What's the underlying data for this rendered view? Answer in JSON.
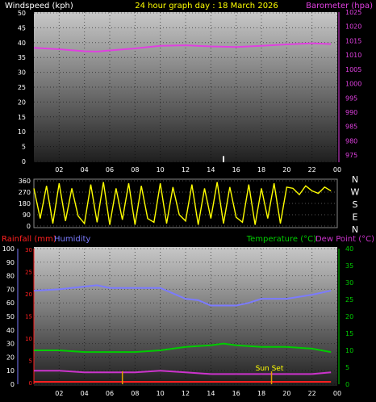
{
  "header": {
    "left": "Windspeed (kph)",
    "center": "24 hour graph day : 18 March 2026",
    "right": "Barometer (hpa)"
  },
  "legend_row": {
    "rainfall": "Rainfall (mm)",
    "humidity": "Humidity",
    "temperature": "Temperature (°C)",
    "dew_point": "Dew Point (°C)"
  },
  "annotations": {
    "sun_set": "Sun Set"
  },
  "colors": {
    "background": "#000000",
    "barometer": "#e040e0",
    "windspeed": "#ffffff",
    "direction": "#ffff00",
    "temperature": "#00cc00",
    "dew_point": "#cc33cc",
    "humidity": "#7b7bff",
    "rainfall": "#ff2020",
    "axis_text": "#ffffff",
    "title": "#ffff00"
  },
  "chart_data": [
    {
      "type": "line",
      "x_ticks": [
        "02",
        "04",
        "06",
        "08",
        "10",
        "12",
        "14",
        "16",
        "18",
        "20",
        "22",
        "00"
      ],
      "y_left": {
        "label": "Windspeed (kph)",
        "ticks": [
          0,
          5,
          10,
          15,
          20,
          25,
          30,
          35,
          40,
          45,
          50
        ],
        "range": [
          0,
          50
        ]
      },
      "y_right": {
        "label": "Barometer (hpa)",
        "ticks": [
          975,
          980,
          985,
          990,
          995,
          1000,
          1005,
          1010,
          1015,
          1020,
          1025
        ],
        "range": [
          972.5,
          1025
        ]
      },
      "series": [
        {
          "name": "Barometer (hpa)",
          "axis": "right",
          "x": [
            0,
            2,
            4,
            5,
            6,
            8,
            10,
            12,
            14,
            16,
            18,
            20,
            22,
            23.5
          ],
          "values": [
            1012.5,
            1012,
            1011.3,
            1011.2,
            1011.6,
            1012.3,
            1013.2,
            1013.4,
            1013.0,
            1012.8,
            1013.2,
            1013.7,
            1014.1,
            1013.8
          ]
        },
        {
          "name": "Windspeed (kph)",
          "axis": "left",
          "x": [
            15
          ],
          "values": [
            1.8
          ]
        }
      ]
    },
    {
      "type": "line",
      "y_left": {
        "ticks": [
          0,
          90,
          180,
          270,
          360
        ],
        "range": [
          0,
          360
        ]
      },
      "y_right": {
        "ticks": [
          "N",
          "W",
          "S",
          "E",
          "N"
        ]
      },
      "series": [
        {
          "name": "Wind Direction",
          "x": [
            0,
            0.5,
            1,
            1.5,
            2,
            2.5,
            3,
            3.5,
            4,
            4.5,
            5,
            5.5,
            6,
            6.5,
            7,
            7.5,
            8,
            8.5,
            9,
            9.5,
            10,
            10.5,
            11,
            11.5,
            12,
            12.5,
            13,
            13.5,
            14,
            14.5,
            15,
            15.5,
            16,
            16.5,
            17,
            17.5,
            18,
            18.5,
            19,
            19.5,
            20,
            20.5,
            21,
            21.5,
            22,
            22.5,
            23,
            23.5
          ],
          "values": [
            300,
            60,
            320,
            20,
            340,
            40,
            300,
            80,
            20,
            330,
            30,
            350,
            10,
            300,
            50,
            340,
            10,
            320,
            60,
            30,
            340,
            20,
            310,
            90,
            40,
            330,
            10,
            300,
            60,
            350,
            20,
            310,
            70,
            30,
            330,
            10,
            300,
            60,
            340,
            20,
            310,
            300,
            250,
            320,
            280,
            260,
            310,
            280
          ]
        }
      ]
    },
    {
      "type": "line",
      "x_ticks": [
        "02",
        "04",
        "06",
        "08",
        "10",
        "12",
        "14",
        "16",
        "18",
        "20",
        "22",
        "00"
      ],
      "y_left": {
        "label": "Rainfall (mm)",
        "ticks": [
          0,
          5,
          10,
          15,
          20,
          25,
          30
        ],
        "range": [
          0,
          30
        ]
      },
      "y_left_humidity": {
        "label": "Humidity",
        "ticks": [
          0,
          10,
          20,
          30,
          40,
          50,
          60,
          70,
          80,
          90,
          100
        ],
        "range": [
          0,
          100
        ]
      },
      "y_right": {
        "label": "Temperature (°C) / Dew Point (°C)",
        "ticks": [
          0,
          5,
          10,
          15,
          20,
          25,
          30,
          35,
          40
        ],
        "range": [
          0,
          40
        ]
      },
      "series": [
        {
          "name": "Humidity",
          "axis": "humidity",
          "x": [
            0,
            2,
            4,
            5,
            6,
            8,
            10,
            11,
            12,
            13,
            14,
            15,
            16,
            17,
            18,
            20,
            22,
            23.5
          ],
          "values": [
            69,
            70,
            72,
            73,
            71,
            71,
            71,
            67,
            63,
            62,
            58,
            58,
            58,
            60,
            63,
            63,
            66,
            69
          ]
        },
        {
          "name": "Temperature (°C)",
          "axis": "right",
          "x": [
            0,
            2,
            4,
            6,
            8,
            10,
            12,
            14,
            15,
            16,
            18,
            20,
            22,
            23.5
          ],
          "values": [
            10,
            10,
            9.5,
            9.5,
            9.5,
            10,
            11,
            11.5,
            12,
            11.5,
            11,
            11,
            10.5,
            9.5
          ]
        },
        {
          "name": "Dew Point (°C)",
          "axis": "right",
          "x": [
            0,
            2,
            4,
            6,
            8,
            10,
            12,
            14,
            16,
            18,
            20,
            22,
            23.5
          ],
          "values": [
            4,
            4,
            3.5,
            3.5,
            3.5,
            4,
            3.5,
            3,
            3,
            3,
            3,
            3,
            3.5
          ]
        },
        {
          "name": "Rainfall (mm)",
          "axis": "left",
          "x": [
            0,
            23.5
          ],
          "values": [
            0,
            0
          ]
        }
      ]
    }
  ]
}
